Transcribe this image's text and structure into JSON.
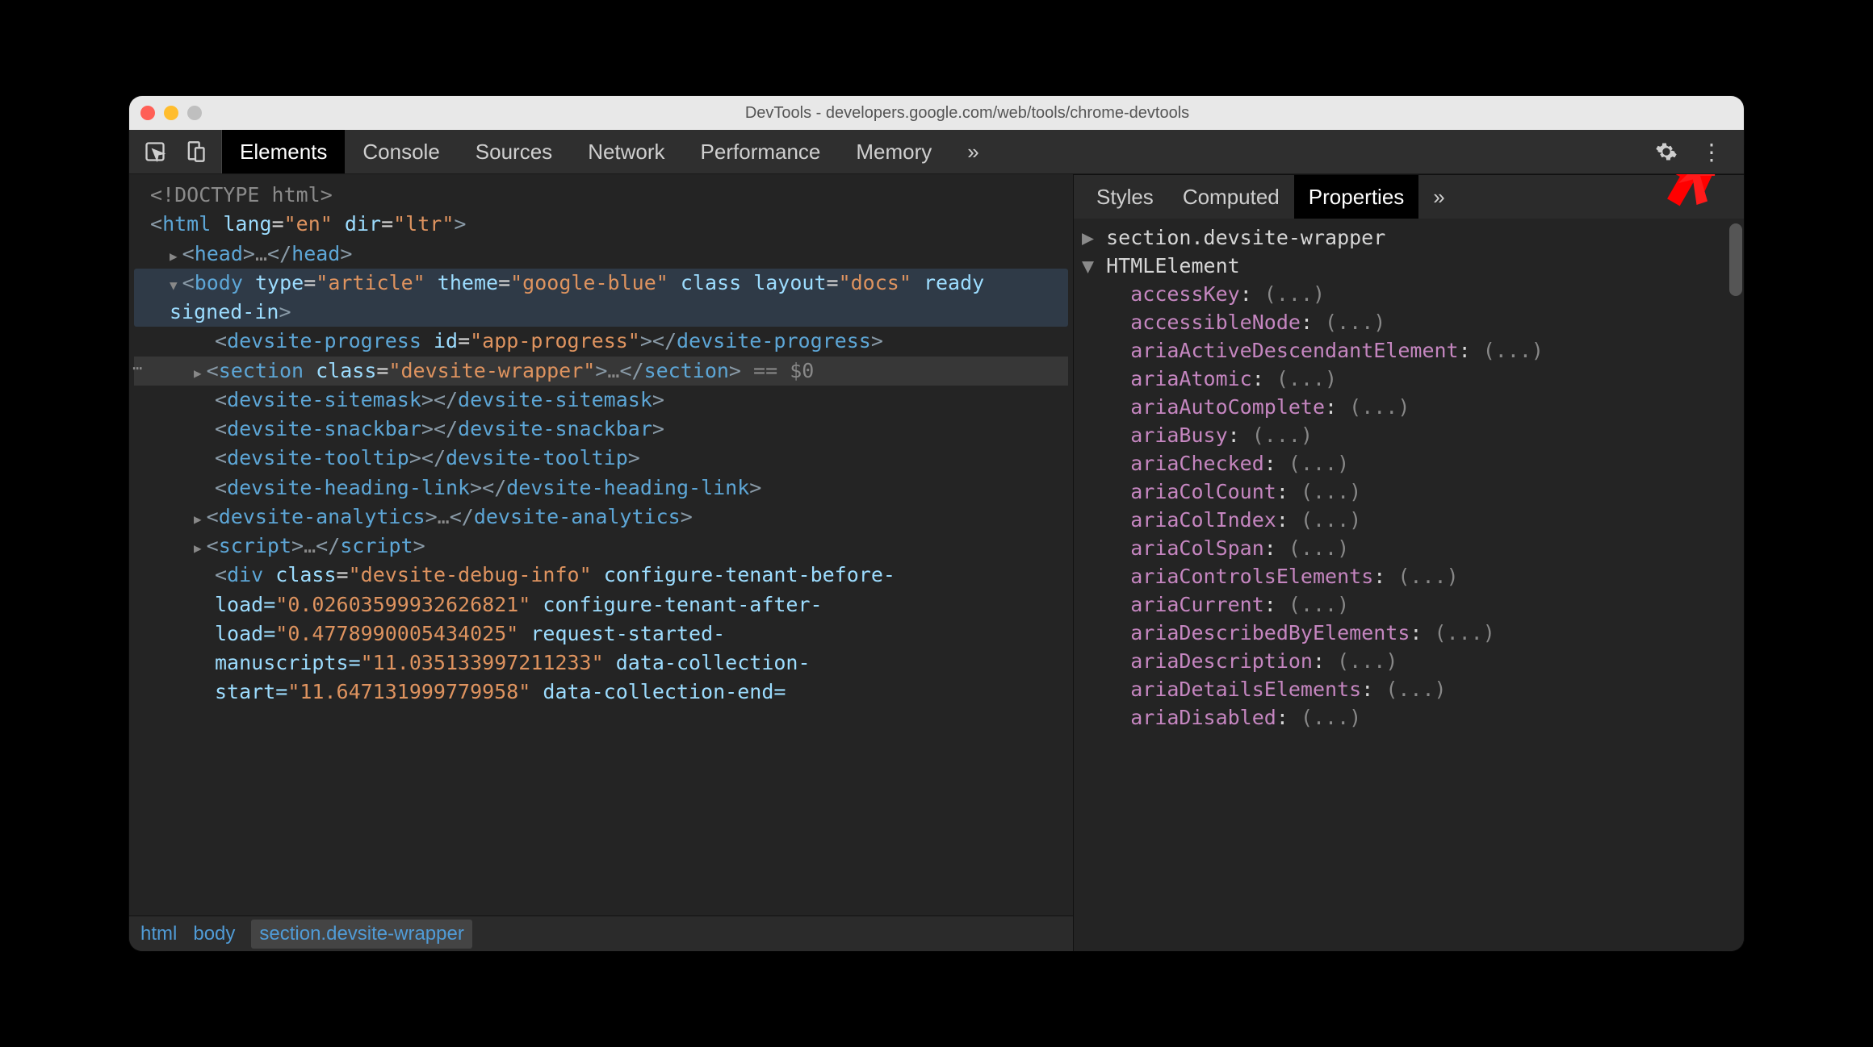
{
  "window_title": "DevTools - developers.google.com/web/tools/chrome-devtools",
  "tabs": [
    "Elements",
    "Console",
    "Sources",
    "Network",
    "Performance",
    "Memory"
  ],
  "active_tab": "Elements",
  "subtabs": [
    "Styles",
    "Computed",
    "Properties"
  ],
  "active_subtab": "Properties",
  "breadcrumb": [
    "html",
    "body",
    "section.devsite-wrapper"
  ],
  "dom": {
    "doctype": "<!DOCTYPE html>",
    "html_open": {
      "tag": "html",
      "attrs": "lang=\"en\" dir=\"ltr\""
    },
    "head": "<head>…</head>",
    "body_open": {
      "tag": "body",
      "attrs": "type=\"article\" theme=\"google-blue\" class layout=\"docs\" ready signed-in"
    },
    "devsite_progress": "<devsite-progress id=\"app-progress\"></devsite-progress>",
    "section_selected": "<section class=\"devsite-wrapper\">…</section>",
    "eq0": "== $0",
    "sitemask": "<devsite-sitemask></devsite-sitemask>",
    "snackbar": "<devsite-snackbar></devsite-snackbar>",
    "tooltip": "<devsite-tooltip></devsite-tooltip>",
    "heading_link": "<devsite-heading-link></devsite-heading-link>",
    "analytics": "<devsite-analytics>…</devsite-analytics>",
    "script": "<script>…</script>",
    "debug_div_tag": "div",
    "debug_div_class": "devsite-debug-info",
    "debug_attrs_1": " configure-tenant-before-load=",
    "debug_val_1": "\"0.02603599932626821\"",
    "debug_attrs_2": " configure-tenant-after-load=",
    "debug_val_2": "\"0.4778990005434025\"",
    "debug_attrs_3": " request-started-manuscripts=",
    "debug_val_3": "\"11.035133997211233\"",
    "debug_attrs_4": " data-collection-start=",
    "debug_val_4": "\"11.647131999779958\"",
    "debug_attrs_5": " data-collection-end="
  },
  "properties": {
    "header1": "section.devsite-wrapper",
    "header2": "HTMLElement",
    "items": [
      "accessKey",
      "accessibleNode",
      "ariaActiveDescendantElement",
      "ariaAtomic",
      "ariaAutoComplete",
      "ariaBusy",
      "ariaChecked",
      "ariaColCount",
      "ariaColIndex",
      "ariaColSpan",
      "ariaControlsElements",
      "ariaCurrent",
      "ariaDescribedByElements",
      "ariaDescription",
      "ariaDetailsElements",
      "ariaDisabled"
    ],
    "ellipsis": "(...)"
  }
}
